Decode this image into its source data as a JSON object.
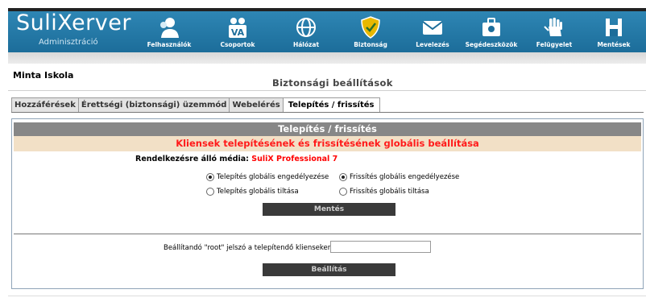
{
  "app": {
    "logo_main": "SuliXerver",
    "logo_sub": "Adminisztráció"
  },
  "nav": [
    {
      "label": "Felhasználók",
      "icon": "users-icon"
    },
    {
      "label": "Csoportok",
      "icon": "groups-icon"
    },
    {
      "label": "Hálózat",
      "icon": "globe-icon"
    },
    {
      "label": "Biztonság",
      "icon": "shield-icon"
    },
    {
      "label": "Levelezés",
      "icon": "mail-icon"
    },
    {
      "label": "Segédeszközök",
      "icon": "toolbox-icon"
    },
    {
      "label": "Felügyelet",
      "icon": "hand-icon"
    },
    {
      "label": "Mentések",
      "icon": "save-icon"
    }
  ],
  "school": "Minta Iskola",
  "page_title": "Biztonsági beállítások",
  "tabs": [
    {
      "label": "Hozzáférések",
      "active": false
    },
    {
      "label": "Érettségi (biztonsági) üzemmód",
      "active": false
    },
    {
      "label": "Webelérés",
      "active": false
    },
    {
      "label": "Telepítés / frissítés",
      "active": true
    }
  ],
  "panel": {
    "title": "Telepítés / frissítés",
    "subtitle": "Kliensek telepítésének és frissítésének globális beállítása",
    "media_label": "Rendelkezésre álló média:",
    "media_value": "SuliX Professional 7",
    "radios": {
      "install_enable": {
        "label": "Telepítés globális engedélyezése",
        "checked": true
      },
      "install_disable": {
        "label": "Telepítés globális tiltása",
        "checked": false
      },
      "update_enable": {
        "label": "Frissítés globális engedélyezése",
        "checked": true
      },
      "update_disable": {
        "label": "Frissítés globális tiltása",
        "checked": false
      }
    },
    "save_button": "Mentés",
    "root_label": "Beállítandó \"root\" jelszó a telepítendő klienseken:",
    "root_value": "",
    "apply_button": "Beállítás"
  },
  "colors": {
    "header": "#1c6d9a",
    "panel_head": "#878787",
    "panel_sub_bg": "#f2e0c6",
    "alert_red": "#ff1a1a",
    "button_bg": "#3a3a3a"
  }
}
